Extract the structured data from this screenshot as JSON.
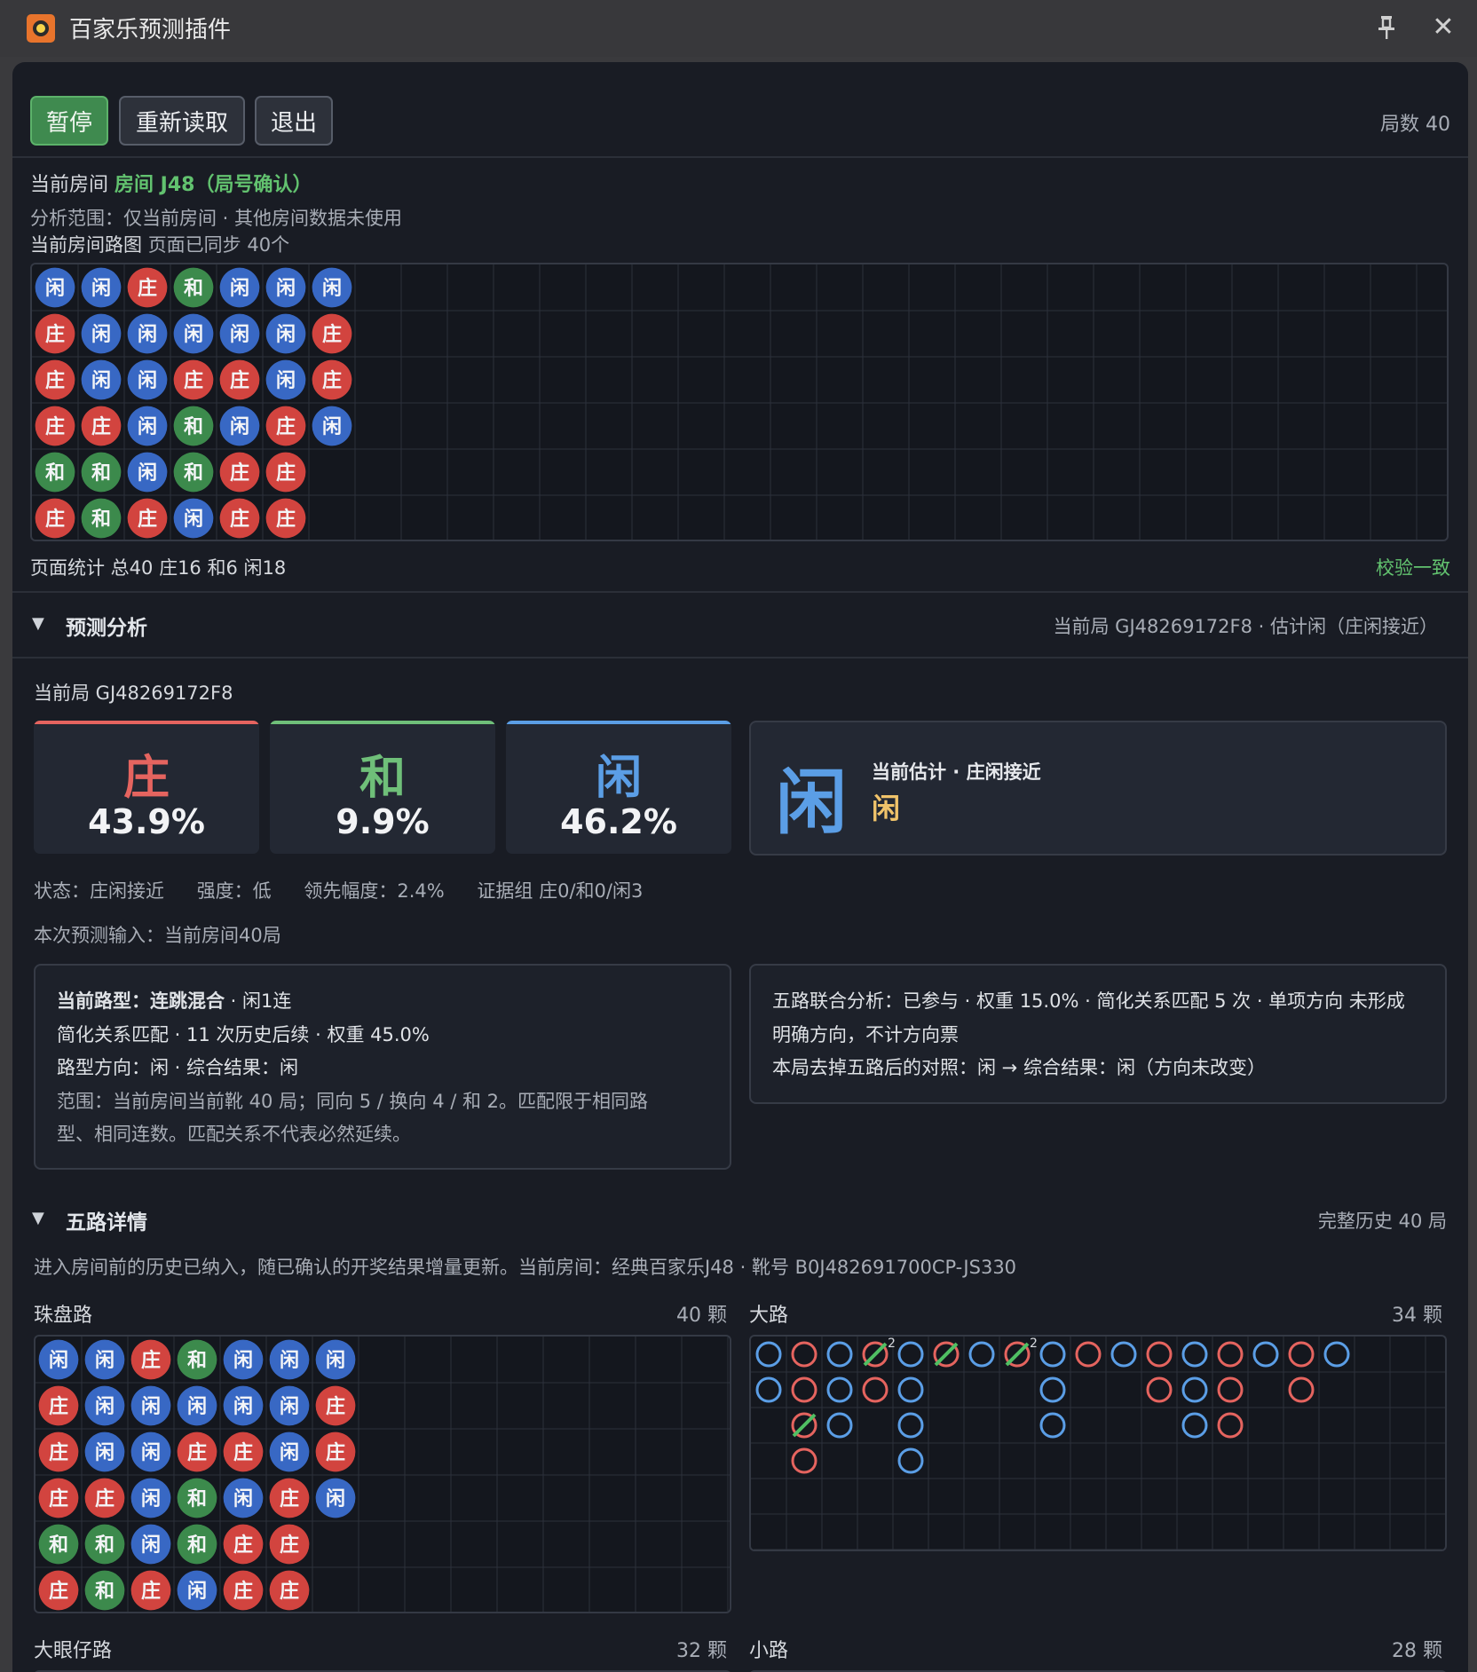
{
  "app": {
    "title": "百家乐预测插件"
  },
  "toolbar": {
    "pause_label": "暂停",
    "reload_label": "重新读取",
    "exit_label": "退出",
    "round_count": "局数 40"
  },
  "room": {
    "label": "当前房间",
    "name": "房间 J48（局号确认）",
    "scope": "分析范围：仅当前房间 · 其他房间数据未使用",
    "road_label": "当前房间路图",
    "road_sync": "页面已同步 40个",
    "stats": "页面统计 总40 庄16 和6 闲18",
    "verify": "校验一致"
  },
  "bead_symbols": {
    "B": "庄",
    "P": "闲",
    "T": "和"
  },
  "bead_columns": [
    [
      "P",
      "B",
      "B",
      "B",
      "T",
      "B"
    ],
    [
      "P",
      "P",
      "P",
      "B",
      "T",
      "T"
    ],
    [
      "B",
      "P",
      "P",
      "P",
      "P",
      "B"
    ],
    [
      "T",
      "P",
      "B",
      "T",
      "T",
      "P"
    ],
    [
      "P",
      "P",
      "B",
      "P",
      "B",
      "B"
    ],
    [
      "P",
      "P",
      "P",
      "B",
      "B",
      "B"
    ],
    [
      "P",
      "B",
      "B",
      "P"
    ]
  ],
  "prediction": {
    "header": "预测分析",
    "header_right": "当前局 GJ48269172F8 · 估计闲（庄闲接近）",
    "current_round": "当前局 GJ48269172F8",
    "cards": [
      {
        "label": "庄",
        "pct": "43.9%",
        "color": "#e5645f"
      },
      {
        "label": "和",
        "pct": "9.9%",
        "color": "#6fbf79"
      },
      {
        "label": "闲",
        "pct": "46.2%",
        "color": "#5b9ee6"
      }
    ],
    "estimate": {
      "big": "闲",
      "title": "当前估计 · 庄闲接近",
      "value": "闲"
    },
    "status": {
      "state": "状态：庄闲接近",
      "strength": "强度：低",
      "lead": "领先幅度：2.4%",
      "evidence": "证据组 庄0/和0/闲3"
    },
    "input": "本次预测输入：当前房间40局",
    "left_box": {
      "l1_bold": "当前路型：连跳混合",
      "l1_rest": " · 闲1连",
      "l2": "简化关系匹配 · 11 次历史后续 · 权重 45.0%",
      "l3": "路型方向：闲 · 综合结果：闲",
      "l4": "范围：当前房间当前靴 40 局；同向 5 / 换向 4 / 和 2。匹配限于相同路",
      "l5": "型、相同连数。匹配关系不代表必然延续。"
    },
    "right_box": {
      "l1": "五路联合分析：已参与 · 权重 15.0% · 简化关系匹配 5 次 · 单项方向 未形成",
      "l2": "明确方向，不计方向票",
      "l3": "本局去掉五路后的对照：闲 → 综合结果：闲（方向未改变）"
    }
  },
  "five_roads": {
    "header": "五路详情",
    "header_right": "完整历史 40 局",
    "note": "进入房间前的历史已纳入，随已确认的开奖结果增量更新。当前房间：经典百家乐J48 · 靴号 B0J482691700CP-JS330",
    "bead_title": "珠盘路",
    "bead_count": "40 颗",
    "big_title": "大路",
    "big_count": "34 颗",
    "eye_title": "大眼仔路",
    "eye_count": "32 颗",
    "small_title": "小路",
    "small_count": "28 颗",
    "big_road_columns": [
      {
        "color": "P",
        "cells": [
          "",
          ""
        ]
      },
      {
        "color": "B",
        "cells": [
          "",
          "",
          "T",
          ""
        ]
      },
      {
        "color": "P",
        "cells": [
          "",
          "",
          ""
        ]
      },
      {
        "color": "B",
        "cells": [
          "T2",
          ""
        ]
      },
      {
        "color": "P",
        "cells": [
          "",
          "",
          "",
          ""
        ]
      },
      {
        "color": "B",
        "cells": [
          "T"
        ]
      },
      {
        "color": "P",
        "cells": [
          ""
        ]
      },
      {
        "color": "B",
        "cells": [
          "T2"
        ]
      },
      {
        "color": "P",
        "cells": [
          "",
          "",
          ""
        ]
      },
      {
        "color": "B",
        "cells": [
          ""
        ]
      },
      {
        "color": "P",
        "cells": [
          ""
        ]
      },
      {
        "color": "B",
        "cells": [
          "",
          ""
        ]
      },
      {
        "color": "P",
        "cells": [
          "",
          "",
          ""
        ]
      },
      {
        "color": "B",
        "cells": [
          "",
          "",
          ""
        ]
      },
      {
        "color": "P",
        "cells": [
          ""
        ]
      },
      {
        "color": "B",
        "cells": [
          "",
          ""
        ]
      },
      {
        "color": "P",
        "cells": [
          ""
        ]
      }
    ]
  },
  "colors": {
    "banker": "#d2443f",
    "player": "#3868c4",
    "tie": "#3c8a4c",
    "banker_ring": "#e5645f",
    "player_ring": "#5b9ee6",
    "tie_slash": "#4fbf63"
  }
}
